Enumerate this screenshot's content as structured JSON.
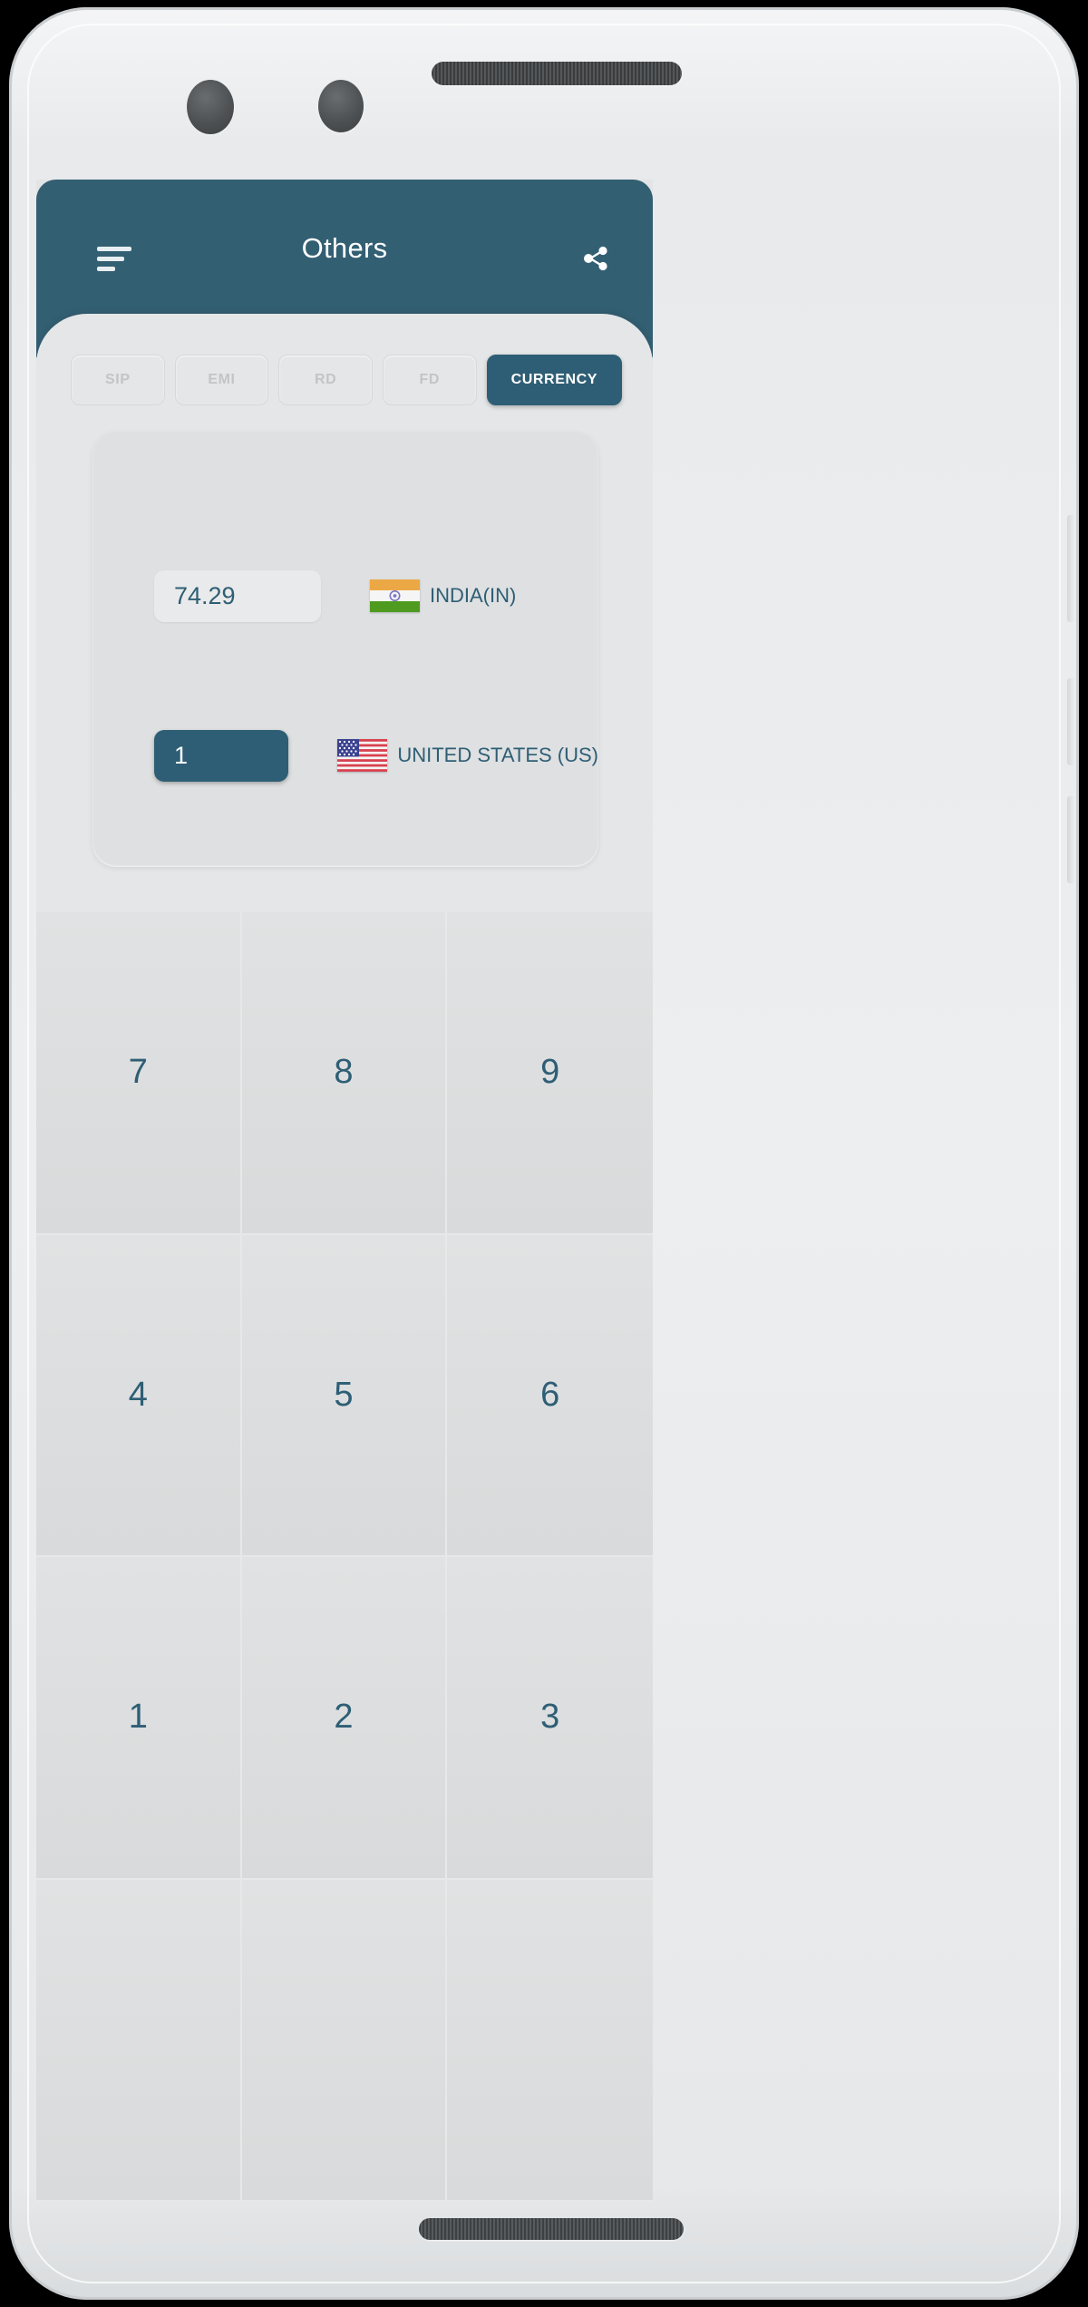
{
  "app": {
    "title": "Others",
    "menu_icon": "hamburger-menu-icon",
    "share_icon": "share-icon",
    "accent_color": "#2e5e75",
    "app_bar_color": "#335f73",
    "screen_bg": "#e2e4e5"
  },
  "tabs": [
    {
      "label": "SIP",
      "active": false
    },
    {
      "label": "EMI",
      "active": false
    },
    {
      "label": "RD",
      "active": false
    },
    {
      "label": "FD",
      "active": false
    },
    {
      "label": "CURRENCY",
      "active": true
    }
  ],
  "converter": {
    "rows": [
      {
        "amount": "74.29",
        "country": "INDIA(IN)",
        "flag": "india-flag-icon",
        "focused": false
      },
      {
        "amount": "1",
        "country": "UNITED STATES (US)",
        "flag": "united-states-flag-icon",
        "focused": true
      }
    ]
  },
  "keypad": {
    "keys": [
      "7",
      "8",
      "9",
      "4",
      "5",
      "6",
      "1",
      "2",
      "3",
      "",
      "",
      ""
    ]
  }
}
